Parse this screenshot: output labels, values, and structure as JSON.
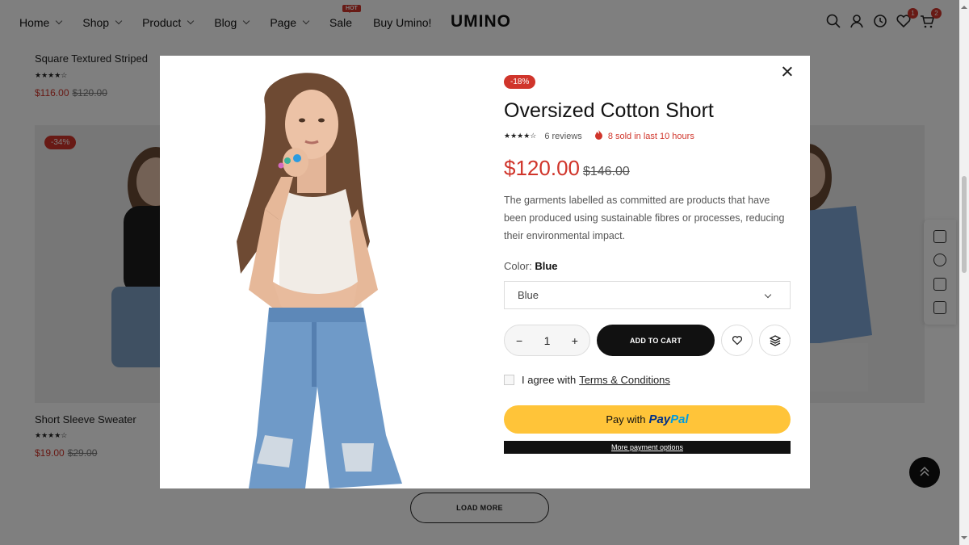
{
  "header": {
    "nav": [
      {
        "label": "Home"
      },
      {
        "label": "Shop"
      },
      {
        "label": "Product"
      },
      {
        "label": "Blog"
      },
      {
        "label": "Page"
      },
      {
        "label": "Sale",
        "badge": "HOT"
      },
      {
        "label": "Buy Umino!"
      }
    ],
    "logo": "UMINO",
    "icons": [
      "search-icon",
      "account-icon",
      "history-icon",
      "wishlist-icon",
      "cart-icon"
    ],
    "wishlist_count": "1",
    "cart_count": "2"
  },
  "background": {
    "products": [
      {
        "title": "Square Textured Striped",
        "price": "$116.00",
        "old_price": "$120.00"
      },
      {
        "title": "Short Sleeve Sweater",
        "price": "$19.00",
        "old_price": "$29.00",
        "badge": "-34%"
      }
    ],
    "load_more": "LOAD MORE"
  },
  "modal": {
    "badge": "-18%",
    "title": "Oversized Cotton Short",
    "rating_stars": "★★★★☆",
    "rating": 4,
    "reviews": "6 reviews",
    "sold": "8 sold in last 10 hours",
    "price": "$120.00",
    "old_price": "$146.00",
    "description": "The garments labelled as committed are products that have been produced using sustainable fibres or processes, reducing their environmental impact.",
    "color_label": "Color:",
    "color_value": "Blue",
    "select_value": "Blue",
    "quantity": "1",
    "add_to_cart": "ADD TO CART",
    "agree_text": "I agree with",
    "terms_link": "Terms & Conditions",
    "paypal_prefix": "Pay with",
    "paypal_brand_1": "Pay",
    "paypal_brand_2": "Pal",
    "more_payment": "More payment options"
  },
  "colors": {
    "accent": "#d0352b",
    "paypal_bg": "#ffc439",
    "dark": "#111111"
  }
}
